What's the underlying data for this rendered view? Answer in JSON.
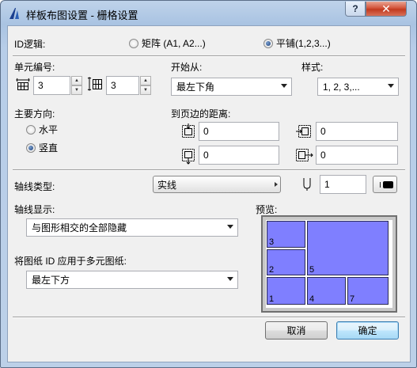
{
  "window": {
    "title": "样板布图设置 - 栅格设置",
    "help_label": "?",
    "close_label": "✕"
  },
  "id_logic": {
    "label": "ID逻辑:",
    "options": [
      {
        "label": "矩阵 (A1, A2...)",
        "selected": false
      },
      {
        "label": "平铺(1,2,3...)",
        "selected": true
      }
    ]
  },
  "cell_numbers": {
    "label": "单元编号:",
    "columns": {
      "icon": "grid-columns-icon",
      "value": "3"
    },
    "rows": {
      "icon": "grid-rows-icon",
      "value": "3"
    }
  },
  "start_from": {
    "label": "开始从:",
    "value": "最左下角"
  },
  "style": {
    "label": "样式:",
    "value": "1, 2, 3,..."
  },
  "main_direction": {
    "label": "主要方向:",
    "options": [
      {
        "label": "水平",
        "selected": false
      },
      {
        "label": "竖直",
        "selected": true
      }
    ]
  },
  "page_margins": {
    "label": "到页边的距离:",
    "top": {
      "icon": "margin-top-icon",
      "value": "0"
    },
    "left": {
      "icon": "margin-left-icon",
      "value": "0"
    },
    "bottom": {
      "icon": "margin-bottom-icon",
      "value": "0"
    },
    "right": {
      "icon": "margin-right-icon",
      "value": "0"
    }
  },
  "line_type": {
    "label": "轴线类型:",
    "value": "实线",
    "pen_icon": "pen-icon",
    "pen_value": "1",
    "pen_color": "#000000"
  },
  "axis_display": {
    "label": "轴线显示:",
    "value": "与图形相交的全部隐藏"
  },
  "apply_id": {
    "label": "将图纸 ID 应用于多元图纸:",
    "value": "最左下方"
  },
  "preview": {
    "label": "预览:",
    "fill_color": "#7f7fff",
    "panes": [
      "3",
      "5",
      "2",
      "1",
      "4",
      "7"
    ]
  },
  "buttons": {
    "cancel": "取消",
    "ok": "确定"
  }
}
